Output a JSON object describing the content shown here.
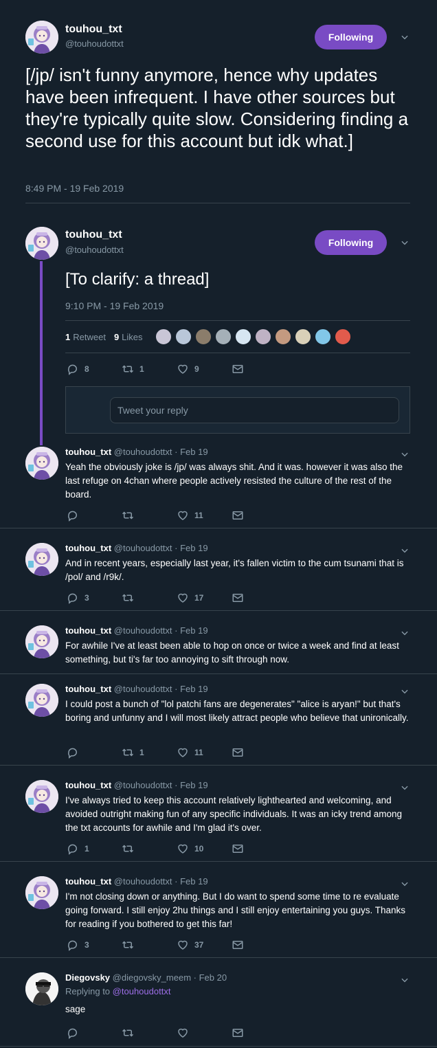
{
  "main_tweet": {
    "name": "touhou_txt",
    "handle": "@touhoudottxt",
    "follow_label": "Following",
    "text": "[/jp/ isn't funny anymore, hence why updates have been infrequent.  I have other sources but they're typically quite slow. Considering finding a second use for this account but idk what.]",
    "timestamp": "8:49 PM - 19 Feb 2019"
  },
  "focus_tweet": {
    "name": "touhou_txt",
    "handle": "@touhoudottxt",
    "follow_label": "Following",
    "text": "[To clarify: a thread]",
    "timestamp": "9:10 PM - 19 Feb 2019",
    "retweet_count": "1",
    "retweet_label": "Retweet",
    "like_count": "9",
    "like_label": "Likes",
    "actions": {
      "replies": "8",
      "retweets": "1",
      "likes": "9"
    },
    "reply_placeholder": "Tweet your reply",
    "liker_colors": [
      "#c9c6d6",
      "#b9c7d9",
      "#8b7d6b",
      "#a5b0b8",
      "#d7e6f2",
      "#bfb2c4",
      "#c49a80",
      "#d9d0b8",
      "#82c7e8",
      "#e25b4c"
    ]
  },
  "replies": [
    {
      "name": "touhou_txt",
      "handle": "@touhoudottxt",
      "date": "· Feb 19",
      "text": "Yeah the obviously joke is /jp/ was always shit.  And it was.  however it was also the last refuge on 4chan where people actively resisted the culture of the rest of the board.",
      "replies": "",
      "retweets": "",
      "likes": "11"
    },
    {
      "name": "touhou_txt",
      "handle": "@touhoudottxt",
      "date": "· Feb 19",
      "text": "And in recent years, especially last year, it's fallen victim to the cum tsunami that is /pol/ and /r9k/.",
      "replies": "3",
      "retweets": "",
      "likes": "17"
    },
    {
      "name": "touhou_txt",
      "handle": "@touhoudottxt",
      "date": "· Feb 19",
      "text": "For awhile I've at least been able to hop on once or twice a week and find at least something, but ti's far too annoying to sift through now."
    },
    {
      "name": "touhou_txt",
      "handle": "@touhoudottxt",
      "date": "· Feb 19",
      "text": "I could post a bunch of \"lol patchi fans are degenerates\" \"alice is aryan!\" but that's boring and unfunny and I will most likely attract people who believe that unironically.",
      "replies": "",
      "retweets": "1",
      "likes": "11"
    },
    {
      "name": "touhou_txt",
      "handle": "@touhoudottxt",
      "date": "· Feb 19",
      "text": "I've always tried to keep this account relatively lighthearted and welcoming, and avoided outright making fun of any specific individuals.  It was an icky trend among the txt accounts for awhile and I'm glad it's over.",
      "replies": "1",
      "retweets": "",
      "likes": "10"
    },
    {
      "name": "touhou_txt",
      "handle": "@touhoudottxt",
      "date": "· Feb 19",
      "text": "I'm not closing down or anything.  But I do want to spend some time to re evaluate going forward.  I still enjoy 2hu things and I still enjoy entertaining you guys.  Thanks for reading if you bothered to get this far!",
      "replies": "3",
      "retweets": "",
      "likes": "37"
    },
    {
      "name": "Diegovsky",
      "handle": "@diegovsky_meem",
      "date": "· Feb 20",
      "replying_prefix": "Replying to",
      "replying_to": "@touhoudottxt",
      "text": "sage",
      "replies": "",
      "retweets": "",
      "likes": ""
    }
  ],
  "colors": {
    "background": "#15202b",
    "accent": "#794bc4",
    "link": "#9d6ee7",
    "muted": "#8899a6",
    "border": "#38444d"
  }
}
